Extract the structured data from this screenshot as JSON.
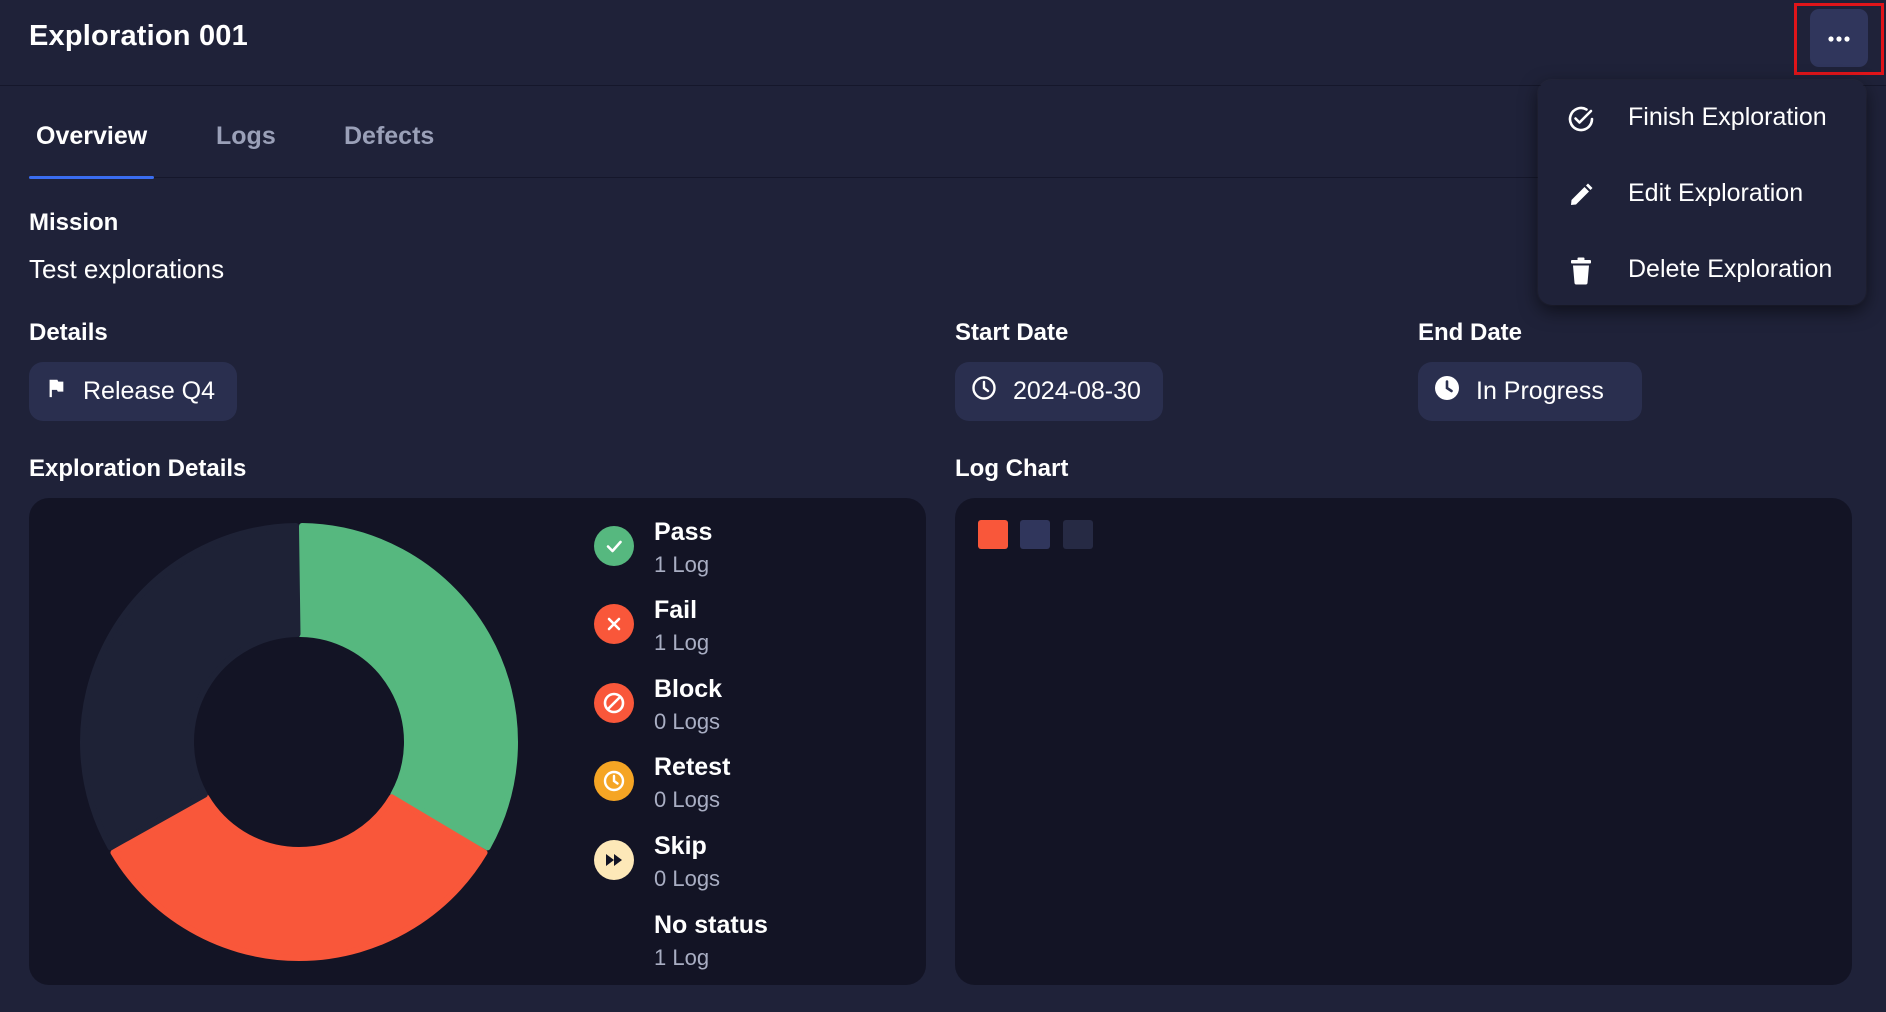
{
  "header": {
    "title": "Exploration 001"
  },
  "tabs": [
    {
      "label": "Overview",
      "active": true
    },
    {
      "label": "Logs",
      "active": false
    },
    {
      "label": "Defects",
      "active": false
    }
  ],
  "mission": {
    "label": "Mission",
    "text": "Test explorations"
  },
  "details": {
    "label": "Details",
    "value": "Release Q4",
    "icon": "flag-icon"
  },
  "start_date": {
    "label": "Start Date",
    "value": "2024-08-30",
    "icon": "clock-icon"
  },
  "end_date": {
    "label": "End Date",
    "value": "In Progress",
    "icon": "clock-filled-icon"
  },
  "exploration_details": {
    "label": "Exploration Details",
    "legend": [
      {
        "name": "Pass",
        "count": "1 Log",
        "color": "#56b87f",
        "icon": "check-circle-icon"
      },
      {
        "name": "Fail",
        "count": "1 Log",
        "color": "#f9573a",
        "icon": "x-circle-icon"
      },
      {
        "name": "Block",
        "count": "0 Logs",
        "color": "#f9573a",
        "icon": "block-circle-icon"
      },
      {
        "name": "Retest",
        "count": "0 Logs",
        "color": "#f5a524",
        "icon": "retest-clock-icon"
      },
      {
        "name": "Skip",
        "count": "0 Logs",
        "color": "#fde8b8",
        "icon": "skip-forward-icon"
      },
      {
        "name": "No status",
        "count": "1 Log",
        "color": "#1e2236",
        "icon": ""
      }
    ]
  },
  "chart_data": {
    "type": "pie",
    "donut": true,
    "categories": [
      "Pass",
      "Fail",
      "No status"
    ],
    "values": [
      1,
      1,
      1
    ],
    "colors": [
      "#56b87f",
      "#f9573a",
      "#1e2236"
    ]
  },
  "log_chart": {
    "label": "Log Chart",
    "swatch_colors": [
      "#f9573a",
      "#30365c",
      "#262a44"
    ]
  },
  "more_menu": {
    "button_icon": "more-horizontal-icon",
    "items": [
      {
        "label": "Finish Exploration",
        "icon": "check-circle-icon"
      },
      {
        "label": "Edit Exploration",
        "icon": "pencil-icon"
      },
      {
        "label": "Delete Exploration",
        "icon": "trash-icon"
      }
    ]
  },
  "colors": {
    "background": "#1f2239",
    "panel": "#131425",
    "chip": "#2a2f4f",
    "accent": "#3a6df0",
    "highlight": "#e0151a"
  }
}
